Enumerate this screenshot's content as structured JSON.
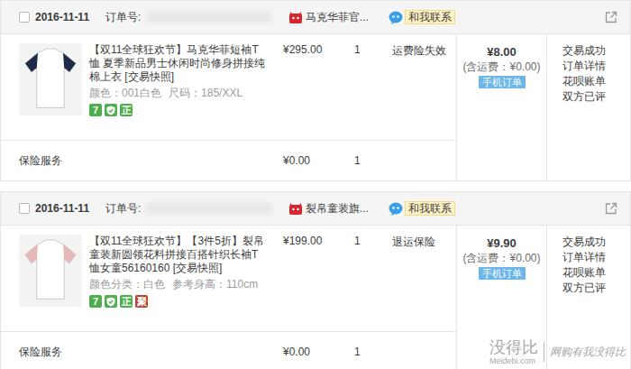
{
  "orders": [
    {
      "checked": false,
      "date": "2016-11-11",
      "order_label": "订单号:",
      "shop": "马克华菲官...",
      "contact": "和我联系",
      "item": {
        "title": "【双11全球狂欢节】马克华菲短袖T恤 夏季新品男士休闲时尚修身拼接纯棉上衣",
        "snapshot": "[交易快照]",
        "specs": [
          "颜色：001白色",
          "尺码：185/XXL"
        ],
        "badges": [
          {
            "kind": "text",
            "label": "7",
            "color": "#4cae4c"
          },
          {
            "kind": "icon",
            "color": "#4cae4c"
          },
          {
            "kind": "text",
            "label": "正",
            "color": "#4cae4c"
          }
        ],
        "price": "¥295.00",
        "qty": "1",
        "service": "运费险失效"
      },
      "total": "¥8.00",
      "shipping": "(含运费：¥0.00)",
      "mobile_tag": "手机订单",
      "status_links": [
        "交易成功",
        "订单详情",
        "花呗账单",
        "双方已评"
      ],
      "insurance": {
        "label": "保险服务",
        "price": "¥0.00",
        "qty": "1"
      }
    },
    {
      "checked": false,
      "date": "2016-11-11",
      "order_label": "订单号:",
      "shop": "裂帛童装旗...",
      "contact": "和我联系",
      "item": {
        "title": "【双11全球狂欢节】【3件5折】裂帛童装新圆领花料拼接百搭针织长袖T恤女童56160160",
        "snapshot": "[交易快照]",
        "specs": [
          "颜色分类：白色",
          "参考身高：110cm"
        ],
        "badges": [
          {
            "kind": "text",
            "label": "7",
            "color": "#4cae4c"
          },
          {
            "kind": "icon",
            "color": "#4cae4c"
          },
          {
            "kind": "text",
            "label": "正",
            "color": "#4cae4c"
          },
          {
            "kind": "text",
            "label": "聚",
            "color": "#b8442e"
          }
        ],
        "price": "¥199.00",
        "qty": "1",
        "service": "退运保险"
      },
      "total": "¥9.90",
      "shipping": "(含运费：¥0.00)",
      "mobile_tag": "手机订单",
      "status_links": [
        "交易成功",
        "订单详情",
        "花呗账单",
        "双方已评"
      ],
      "insurance": {
        "label": "保险服务",
        "price": "¥0.00",
        "qty": "1"
      }
    }
  ],
  "watermark": {
    "logo": "没得比",
    "site": "Meidebi.com",
    "slogan": "网购有我没得比"
  }
}
